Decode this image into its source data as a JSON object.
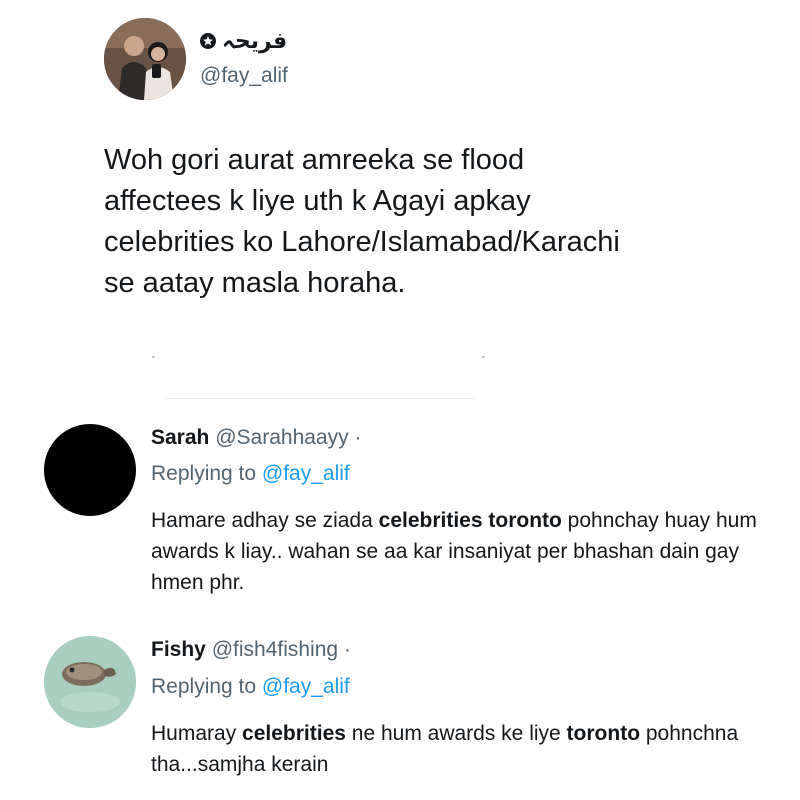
{
  "main_tweet": {
    "display_name": "فریحہ",
    "handle": "@fay_alif",
    "text": "Woh gori aurat amreeka se flood\naffectees k liye uth k Agayi apkay\ncelebrities ko Lahore/Islamabad/Karachi\nse aatay masla horaha."
  },
  "replies": [
    {
      "name": "Sarah",
      "handle": "@Sarahhaayy",
      "separator": "·",
      "replying_prefix": "Replying to",
      "replying_to": "@fay_alif",
      "body": {
        "part1": "Hamare adhay se ziada ",
        "bold1": "celebrities toronto",
        "part2": " pohnchay huay hum awards k liay.. wahan se aa kar insaniyat per bhashan dain gay hmen phr."
      }
    },
    {
      "name": "Fishy",
      "handle": "@fish4fishing",
      "separator": "·",
      "replying_prefix": "Replying to",
      "replying_to": "@fay_alif",
      "body": {
        "part1": "Humaray ",
        "bold1": "celebrities",
        "part2": " ne hum awards ke liye ",
        "bold2": "toronto",
        "part3": " pohnchna tha...samjha kerain"
      }
    }
  ],
  "colors": {
    "text_primary": "#14171a",
    "text_secondary": "#536471",
    "link": "#1d9bf0"
  },
  "icons": [
    "profile-photo",
    "star-badge-icon",
    "black-avatar",
    "fish-avatar"
  ]
}
